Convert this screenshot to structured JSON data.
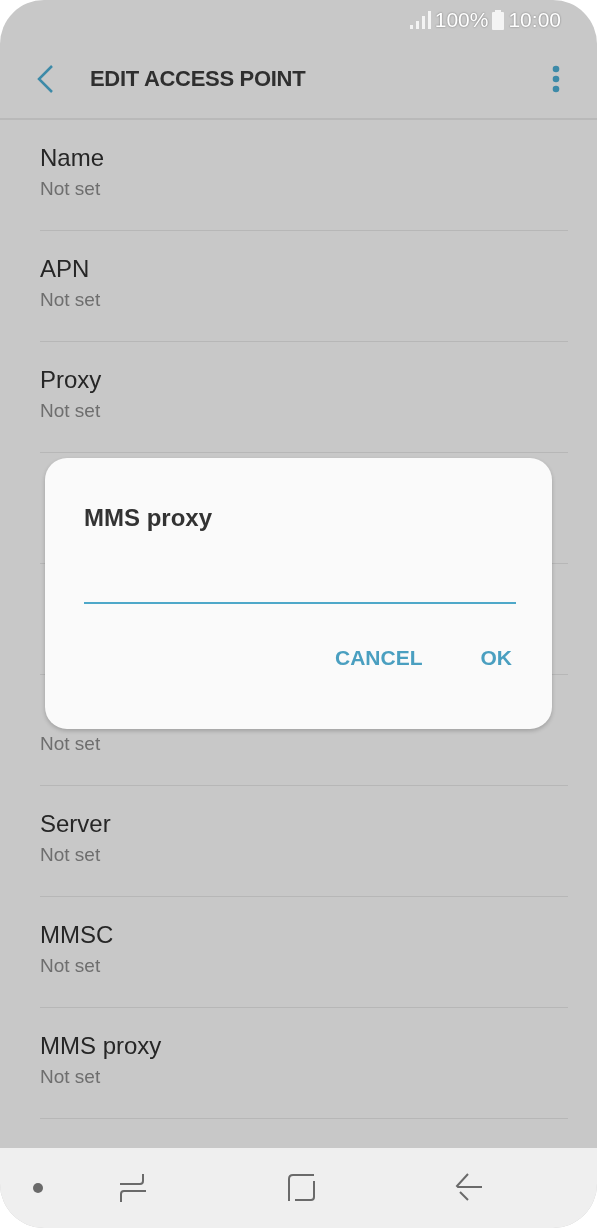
{
  "status_bar": {
    "battery": "100%",
    "time": "10:00"
  },
  "header": {
    "title": "EDIT ACCESS POINT"
  },
  "rows": [
    {
      "kind": "setting",
      "title": "Name",
      "value": "Not set"
    },
    {
      "kind": "setting",
      "title": "APN",
      "value": "Not set"
    },
    {
      "kind": "setting",
      "title": "Proxy",
      "value": "Not set"
    },
    {
      "kind": "covered"
    },
    {
      "kind": "covered"
    },
    {
      "kind": "setting",
      "value": "Not set"
    },
    {
      "kind": "setting",
      "title": "Server",
      "value": "Not set"
    },
    {
      "kind": "setting",
      "title": "MMSC",
      "value": "Not set"
    },
    {
      "kind": "setting",
      "title": "MMS proxy",
      "value": "Not set"
    }
  ],
  "dialog": {
    "title": "MMS proxy",
    "buttons": [
      "CANCEL",
      "OK"
    ]
  }
}
